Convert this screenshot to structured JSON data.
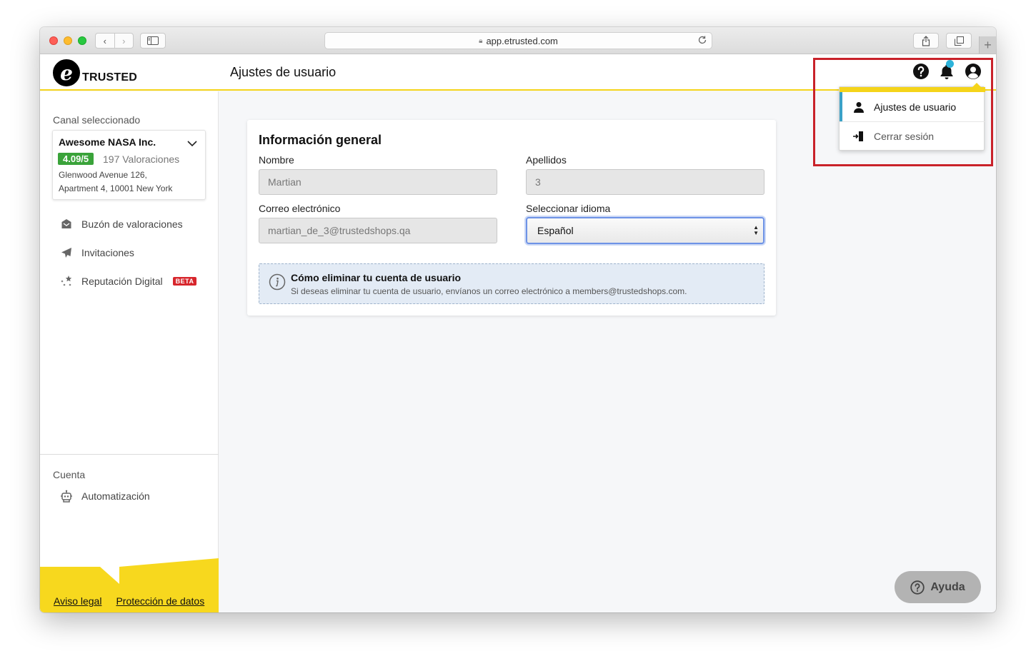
{
  "browser": {
    "url": "app.etrusted.com",
    "nav_back": "‹",
    "nav_forward": "›",
    "new_tab": "+"
  },
  "header": {
    "logo_letter": "e",
    "logo_text": "TRUSTED",
    "page_title": "Ajustes de usuario"
  },
  "sidebar": {
    "channel_label": "Canal seleccionado",
    "channel": {
      "name": "Awesome NASA Inc.",
      "rating": "4.09/5",
      "rating_count": "197 Valoraciones",
      "address_line1": "Glenwood Avenue 126,",
      "address_line2": "Apartment 4, 10001 New York"
    },
    "nav": [
      {
        "label": "Buzón de valoraciones",
        "icon": "inbox-icon"
      },
      {
        "label": "Invitaciones",
        "icon": "paper-plane-icon"
      },
      {
        "label": "Reputación Digital",
        "icon": "stars-icon",
        "badge": "BETA"
      }
    ],
    "account_label": "Cuenta",
    "account_nav": [
      {
        "label": "Automatización",
        "icon": "robot-icon"
      }
    ],
    "footer": {
      "legal": "Aviso legal",
      "privacy": "Protección de datos"
    }
  },
  "form": {
    "title": "Información general",
    "first_name_label": "Nombre",
    "first_name_value": "Martian",
    "last_name_label": "Apellidos",
    "last_name_value": "3",
    "email_label": "Correo electrónico",
    "email_value": "martian_de_3@trustedshops.qa",
    "language_label": "Seleccionar idioma",
    "language_value": "Español",
    "info_title": "Cómo eliminar tu cuenta de usuario",
    "info_text": "Si deseas eliminar tu cuenta de usuario, envíanos un correo electrónico a members@trustedshops.com."
  },
  "user_menu": {
    "settings": "Ajustes de usuario",
    "logout": "Cerrar sesión"
  },
  "help_button": "Ayuda",
  "colors": {
    "brand_yellow": "#f5d41a",
    "rating_green": "#3aa33a",
    "beta_red": "#d7262c",
    "highlight_red": "#c9222a",
    "active_accent": "#3aa2c8"
  }
}
